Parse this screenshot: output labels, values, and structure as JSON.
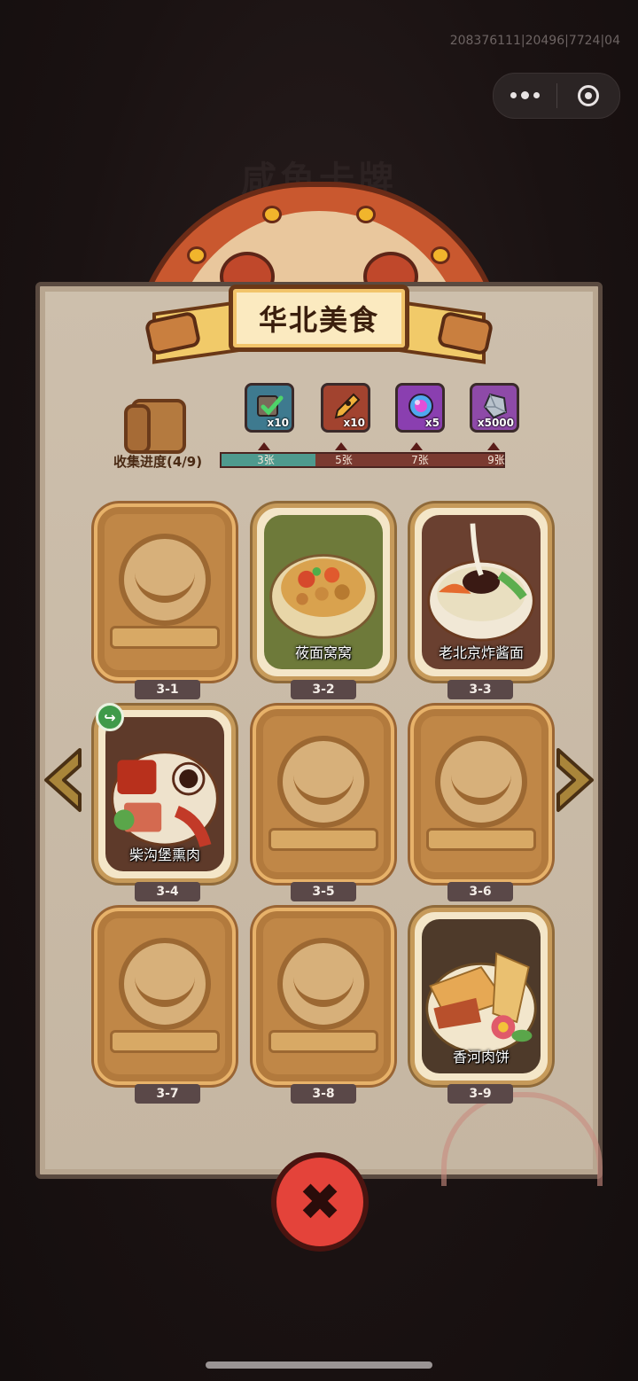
{
  "status": {
    "debug_text": "208376111|20496|7724|04"
  },
  "capsule": {
    "more_icon": "more-dots-icon",
    "close_icon": "target-circle-icon"
  },
  "background": {
    "title": "咸鱼卡牌"
  },
  "panel": {
    "title": "华北美食",
    "progress_label": "收集进度(4/9)",
    "progress": {
      "collected": 4,
      "total": 9
    },
    "milestones": [
      {
        "label": "3张",
        "reward_icon": "card-check-icon",
        "qty": "x10",
        "color": "#3e7a8f"
      },
      {
        "label": "5张",
        "reward_icon": "pen-nib-icon",
        "qty": "x10",
        "color": "#a2432f"
      },
      {
        "label": "7张",
        "reward_icon": "orb-icon",
        "qty": "x5",
        "color": "#8a3fb0"
      },
      {
        "label": "9张",
        "reward_icon": "crystal-icon",
        "qty": "x5000",
        "color": "#8e4aa8"
      }
    ]
  },
  "cards": [
    {
      "id": "3-1",
      "name": "",
      "unlocked": false
    },
    {
      "id": "3-2",
      "name": "莜面窝窝",
      "unlocked": true
    },
    {
      "id": "3-3",
      "name": "老北京炸酱面",
      "unlocked": true
    },
    {
      "id": "3-4",
      "name": "柴沟堡熏肉",
      "unlocked": true
    },
    {
      "id": "3-5",
      "name": "",
      "unlocked": false
    },
    {
      "id": "3-6",
      "name": "",
      "unlocked": false
    },
    {
      "id": "3-7",
      "name": "",
      "unlocked": false
    },
    {
      "id": "3-8",
      "name": "",
      "unlocked": false
    },
    {
      "id": "3-9",
      "name": "香河肉饼",
      "unlocked": true
    }
  ],
  "nav": {
    "prev_icon": "arrow-left-icon",
    "next_icon": "arrow-right-icon",
    "close_icon": "close-x-icon",
    "share_icon": "share-icon"
  }
}
